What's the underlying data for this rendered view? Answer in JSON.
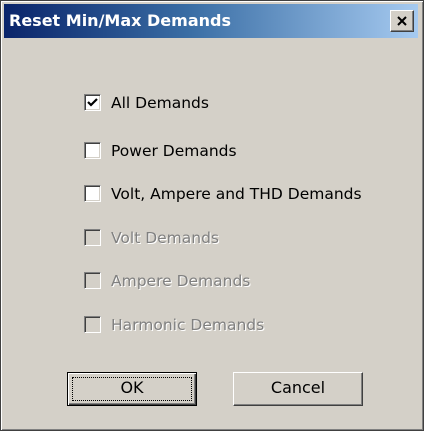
{
  "dialog": {
    "title": "Reset Min/Max Demands",
    "close_icon": "close-icon",
    "colors": {
      "titlebar_start": "#0a246a",
      "titlebar_end": "#a6caf0",
      "face": "#d4d0c8",
      "disabled_text": "#808080"
    }
  },
  "options": [
    {
      "label": "All Demands",
      "checked": true,
      "enabled": true
    },
    {
      "label": "Power Demands",
      "checked": false,
      "enabled": true
    },
    {
      "label": "Volt, Ampere and THD Demands",
      "checked": false,
      "enabled": true
    },
    {
      "label": "Volt Demands",
      "checked": false,
      "enabled": false
    },
    {
      "label": "Ampere Demands",
      "checked": false,
      "enabled": false
    },
    {
      "label": "Harmonic Demands",
      "checked": false,
      "enabled": false
    }
  ],
  "buttons": {
    "ok_label": "OK",
    "cancel_label": "Cancel"
  }
}
